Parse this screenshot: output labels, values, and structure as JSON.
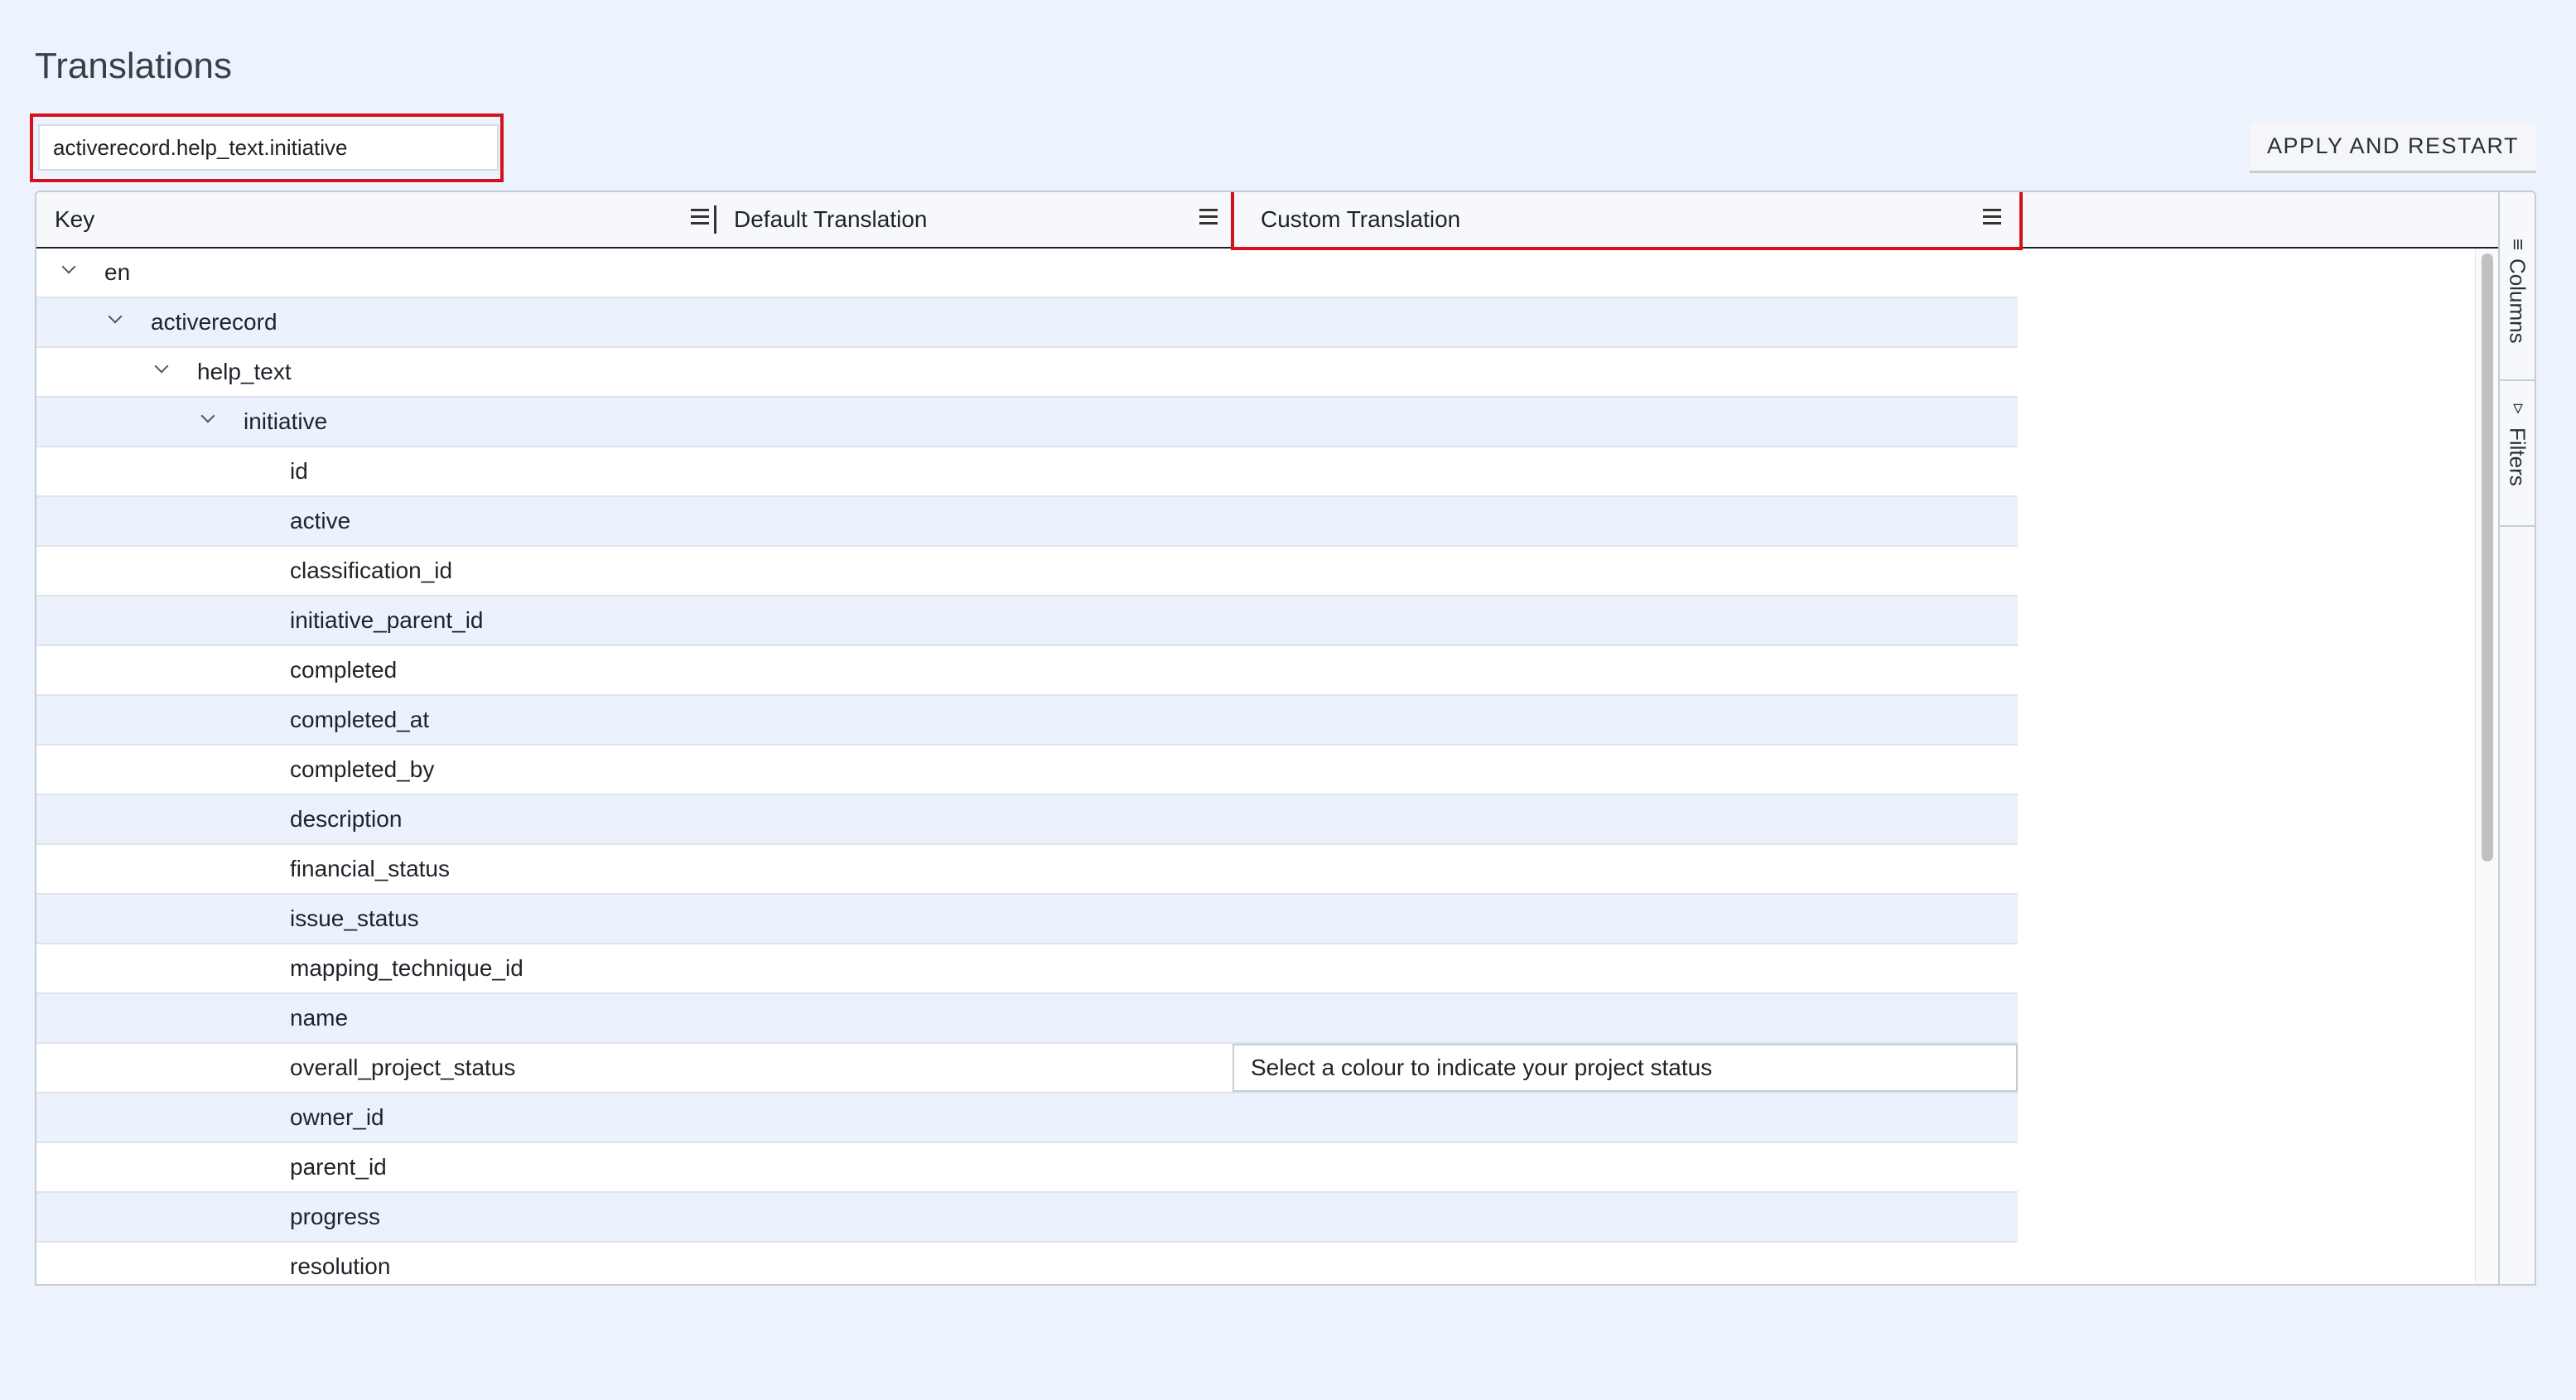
{
  "page": {
    "title": "Translations"
  },
  "search": {
    "value": "activerecord.help_text.initiative",
    "placeholder": ""
  },
  "toolbar": {
    "apply_label": "APPLY AND RESTART"
  },
  "grid": {
    "columns": [
      {
        "label": "Key",
        "menu_icon": "menu-icon"
      },
      {
        "label": "Default Translation",
        "menu_icon": "menu-icon"
      },
      {
        "label": "Custom Translation",
        "menu_icon": "menu-icon"
      }
    ],
    "rows": [
      {
        "key": "en",
        "level": 0,
        "expanded": true,
        "custom": ""
      },
      {
        "key": "activerecord",
        "level": 1,
        "expanded": true,
        "custom": ""
      },
      {
        "key": "help_text",
        "level": 2,
        "expanded": true,
        "custom": ""
      },
      {
        "key": "initiative",
        "level": 3,
        "expanded": true,
        "custom": ""
      },
      {
        "key": "id",
        "level": 4,
        "custom": ""
      },
      {
        "key": "active",
        "level": 4,
        "custom": ""
      },
      {
        "key": "classification_id",
        "level": 4,
        "custom": ""
      },
      {
        "key": "initiative_parent_id",
        "level": 4,
        "custom": ""
      },
      {
        "key": "completed",
        "level": 4,
        "custom": ""
      },
      {
        "key": "completed_at",
        "level": 4,
        "custom": ""
      },
      {
        "key": "completed_by",
        "level": 4,
        "custom": ""
      },
      {
        "key": "description",
        "level": 4,
        "custom": ""
      },
      {
        "key": "financial_status",
        "level": 4,
        "custom": ""
      },
      {
        "key": "issue_status",
        "level": 4,
        "custom": ""
      },
      {
        "key": "mapping_technique_id",
        "level": 4,
        "custom": ""
      },
      {
        "key": "name",
        "level": 4,
        "custom": ""
      },
      {
        "key": "overall_project_status",
        "level": 4,
        "custom": "Select a colour to indicate your project status"
      },
      {
        "key": "owner_id",
        "level": 4,
        "custom": ""
      },
      {
        "key": "parent_id",
        "level": 4,
        "custom": ""
      },
      {
        "key": "progress",
        "level": 4,
        "custom": ""
      },
      {
        "key": "resolution",
        "level": 4,
        "custom": ""
      }
    ]
  },
  "side_panel": {
    "tabs": [
      {
        "label": "Columns",
        "icon": "columns-icon"
      },
      {
        "label": "Filters",
        "icon": "filter-icon"
      }
    ]
  },
  "colors": {
    "highlight": "#d4111c",
    "row_alt": "#ebf2fd",
    "page_bg": "#edf3fd"
  }
}
